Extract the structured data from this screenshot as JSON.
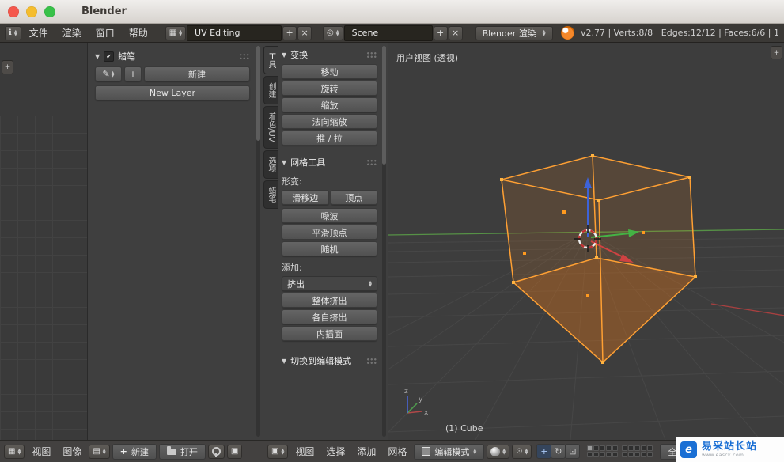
{
  "window": {
    "title": "Blender"
  },
  "menubar": {
    "menus": [
      {
        "label": "文件"
      },
      {
        "label": "渲染"
      },
      {
        "label": "窗口"
      },
      {
        "label": "帮助"
      }
    ],
    "layout": {
      "value": "UV Editing",
      "add": "+",
      "close": "×"
    },
    "scene": {
      "value": "Scene",
      "add": "+",
      "close": "×"
    },
    "engine": {
      "value": "Blender 渲染"
    },
    "stats": "v2.77 | Verts:8/8 | Edges:12/12 | Faces:6/6 | 1"
  },
  "uv_editor": {
    "grease_pencil": {
      "panel_title": "蜡笔",
      "add_button": "+",
      "new_button": "新建",
      "new_layer_button": "New Layer"
    },
    "header": {
      "menus": [
        {
          "label": "视图"
        },
        {
          "label": "图像"
        }
      ],
      "new_button": "新建",
      "open_button": "打开"
    }
  },
  "toolshelf": {
    "tabs": [
      {
        "label": "工具",
        "active": true
      },
      {
        "label": "创建"
      },
      {
        "label": "着色/UV"
      },
      {
        "label": "选项"
      },
      {
        "label": "蜡笔"
      }
    ],
    "transform": {
      "title": "变换",
      "buttons": [
        {
          "label": "移动"
        },
        {
          "label": "旋转"
        },
        {
          "label": "缩放"
        },
        {
          "label": "法向缩放"
        },
        {
          "label": "推 / 拉"
        }
      ]
    },
    "mesh_tools": {
      "title": "网格工具",
      "deform_label": "形变:",
      "slide_buttons": [
        {
          "label": "滑移边"
        },
        {
          "label": "顶点"
        }
      ],
      "deform_buttons": [
        {
          "label": "噪波"
        },
        {
          "label": "平滑顶点"
        },
        {
          "label": "随机"
        }
      ],
      "add_label": "添加:",
      "extrude_menu": "挤出",
      "add_buttons": [
        {
          "label": "整体挤出"
        },
        {
          "label": "各自挤出"
        },
        {
          "label": "内插面"
        }
      ]
    },
    "redo_panel": {
      "title": "切换到编辑模式"
    }
  },
  "viewport": {
    "view_label": "用户视图 (透视)",
    "object_info": "(1) Cube",
    "axis": {
      "x": "x",
      "y": "y",
      "z": "z"
    }
  },
  "view3d_header": {
    "menus": [
      {
        "label": "视图"
      },
      {
        "label": "选择"
      },
      {
        "label": "添加"
      },
      {
        "label": "网格"
      }
    ],
    "mode": {
      "value": "编辑模式"
    },
    "orientation": {
      "value": "全局"
    }
  },
  "watermark": {
    "title": "易采站长站",
    "subtitle": "www.easck.com"
  },
  "colors": {
    "selection_orange": "#ffa033",
    "axis_x": "#a84040",
    "axis_y": "#569146",
    "axis_z": "#3d63d8"
  }
}
